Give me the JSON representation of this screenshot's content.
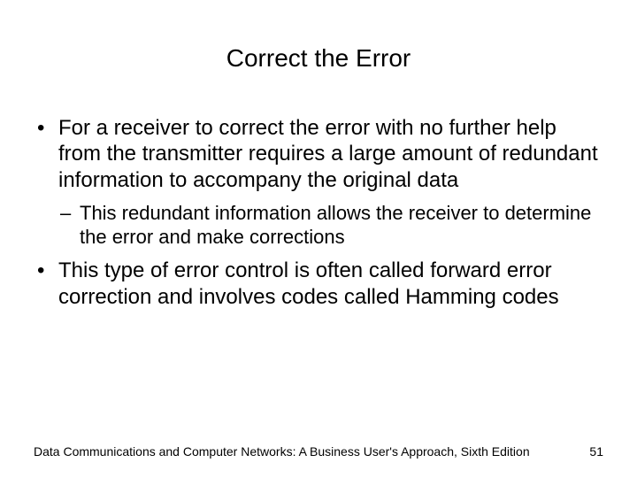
{
  "slide": {
    "title": "Correct the Error",
    "bullets": [
      {
        "text": "For a receiver to correct the error with no further help from the transmitter requires a large amount of redundant information to accompany the original data",
        "children": [
          {
            "text": "This redundant information allows the receiver to determine the error and make corrections"
          }
        ]
      },
      {
        "text": "This type of error control is often called forward error correction and involves codes called Hamming codes",
        "children": []
      }
    ],
    "footer_text": "Data Communications and Computer Networks: A Business User's Approach, Sixth Edition",
    "page_number": "51"
  }
}
